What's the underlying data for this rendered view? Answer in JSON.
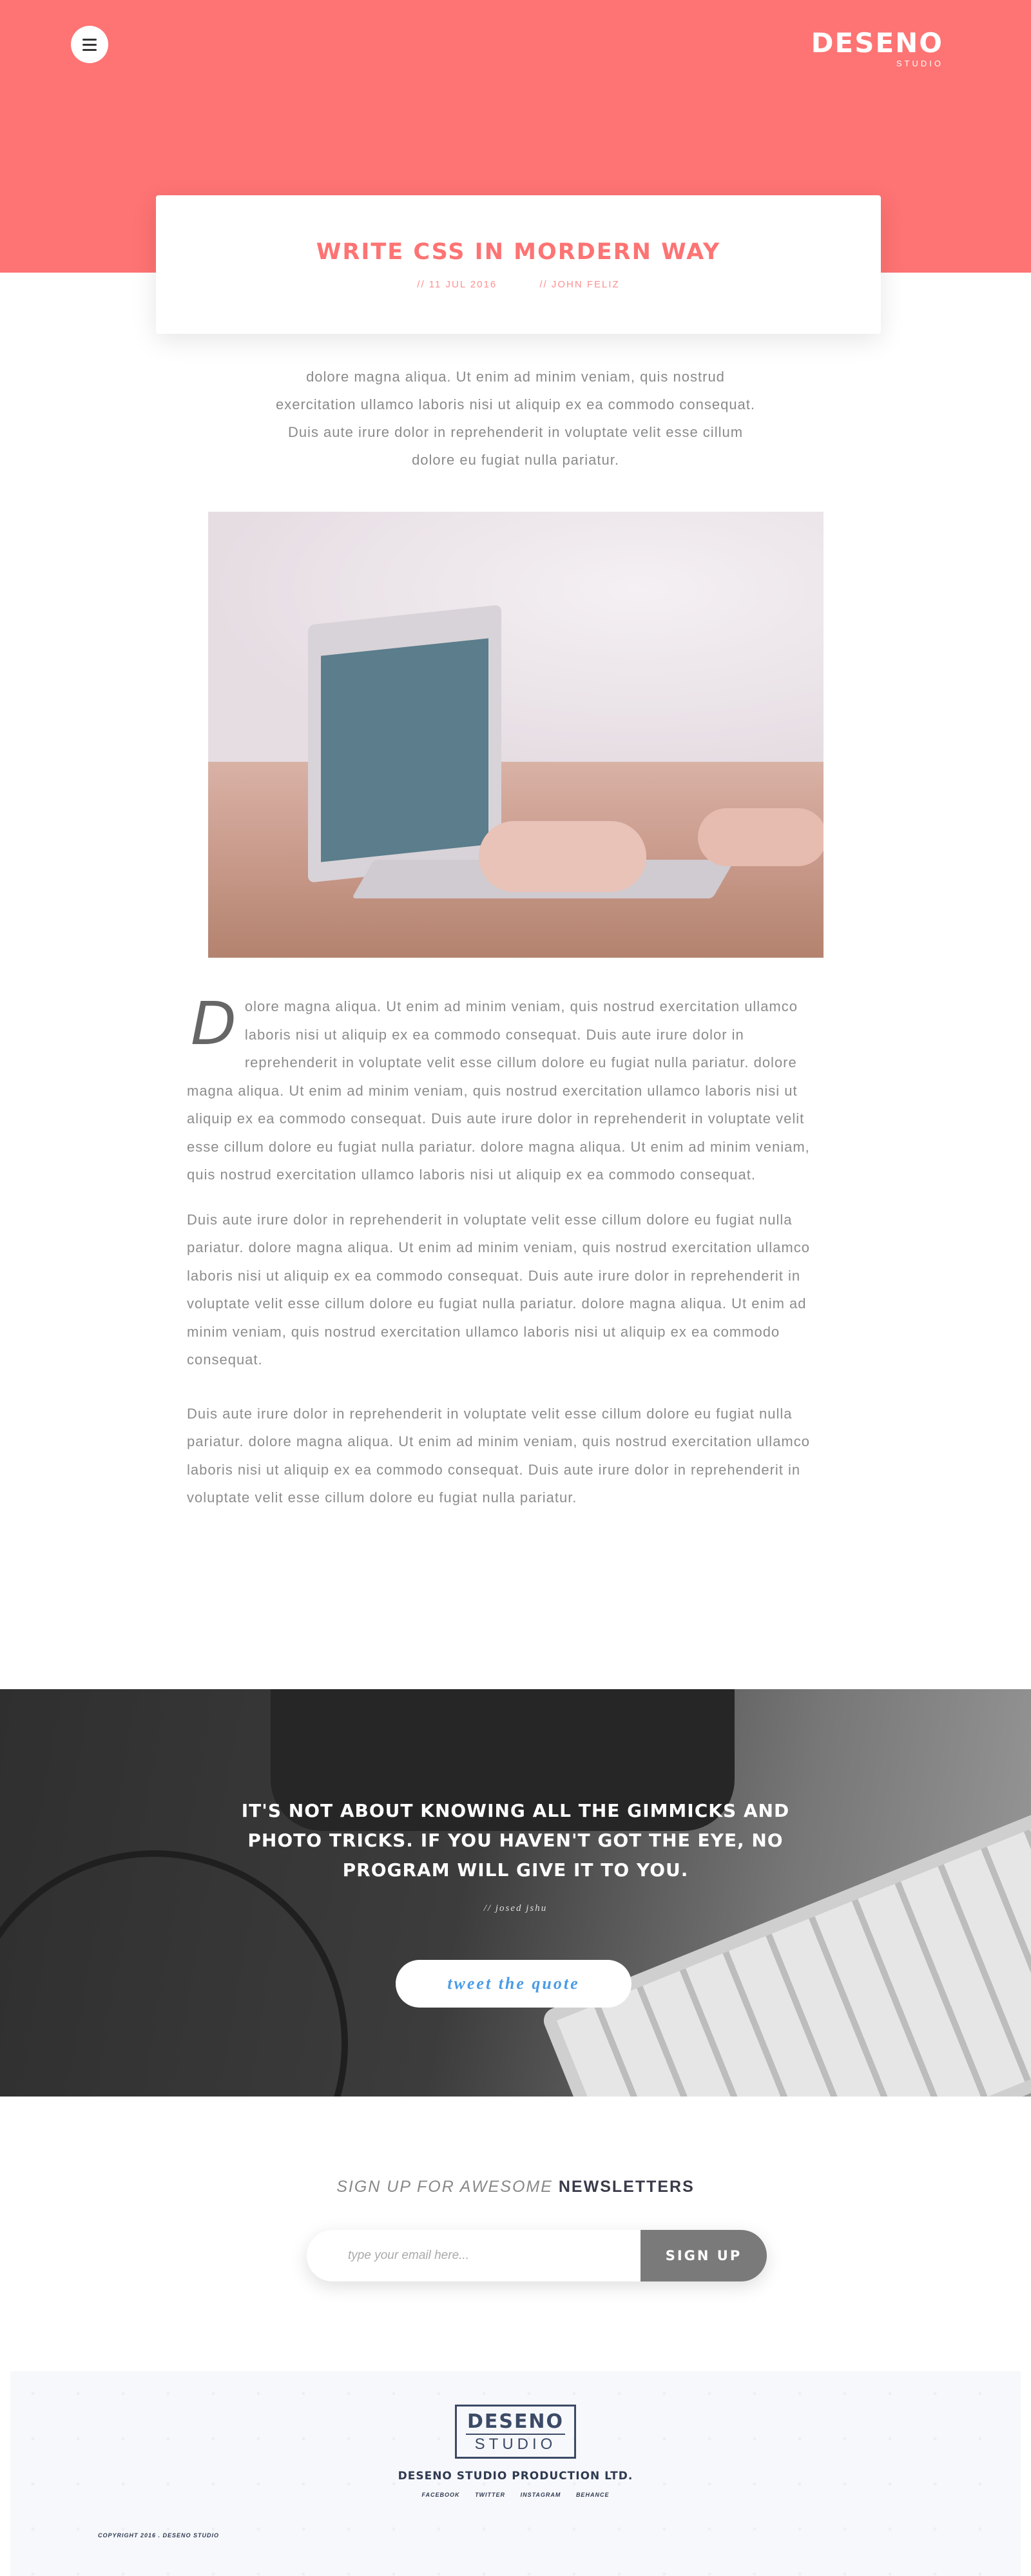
{
  "header": {
    "menu_icon": "hamburger-menu-icon",
    "brand_name": "DESENO",
    "brand_sub": "STUDIO",
    "accent_color": "#fe7373"
  },
  "post": {
    "title": "WRITE CSS IN MORDERN WAY",
    "date": "// 11 JUL 2016",
    "author": "// JOHN FELIZ"
  },
  "intro": "dolore magna aliqua. Ut enim ad minim veniam, quis nostrud exercitation ullamco laboris nisi ut aliquip ex ea commodo consequat. Duis aute irure dolor in reprehenderit in voluptate velit esse cillum dolore eu fugiat nulla pariatur.",
  "article": {
    "dropcap": "D",
    "p1": "olore magna aliqua. Ut enim ad minim veniam, quis nostrud exercitation ullamco laboris nisi ut aliquip ex ea commodo consequat. Duis aute irure dolor in reprehenderit in voluptate velit esse cillum dolore eu fugiat nulla pariatur. dolore magna aliqua. Ut enim ad minim veniam, quis nostrud exercitation ullamco laboris nisi ut aliquip ex ea commodo consequat. Duis aute irure dolor in reprehenderit in voluptate velit esse cillum dolore eu fugiat nulla pariatur. dolore magna aliqua. Ut enim ad minim veniam, quis nostrud exercitation ullamco laboris nisi ut aliquip ex ea commodo consequat.",
    "p2": "Duis aute irure dolor in reprehenderit in voluptate velit esse cillum dolore eu fugiat nulla pariatur. dolore magna aliqua. Ut enim ad minim veniam, quis nostrud exercitation ullamco laboris nisi ut aliquip ex ea commodo consequat. Duis aute irure dolor in reprehenderit in voluptate velit esse cillum dolore eu fugiat nulla pariatur. dolore magna aliqua. Ut enim ad minim veniam, quis nostrud exercitation ullamco laboris nisi ut aliquip ex ea commodo consequat.",
    "p3": "Duis aute irure dolor in reprehenderit in voluptate velit esse cillum dolore eu fugiat nulla pariatur. dolore magna aliqua. Ut enim ad minim veniam, quis nostrud exercitation ullamco laboris nisi ut aliquip ex ea commodo consequat. Duis aute irure dolor in reprehenderit in voluptate velit esse cillum dolore eu fugiat nulla pariatur."
  },
  "quote": {
    "text": "IT'S NOT ABOUT KNOWING ALL THE GIMMICKS AND PHOTO TRICKS. IF YOU HAVEN'T GOT THE EYE, NO PROGRAM WILL GIVE IT TO YOU.",
    "author": "// josed jshu",
    "button_label": "tweet the quote",
    "button_color": "#4a9be6"
  },
  "newsletter": {
    "heading_light": "SIGN UP FOR AWESOME ",
    "heading_strong": "NEWSLETTERS",
    "placeholder": "type your email here...",
    "submit_label": "SIGN UP"
  },
  "footer": {
    "logo_top": "DESENO",
    "logo_bottom": "STUDIO",
    "company": "DESENO STUDIO PRODUCTION LTD.",
    "social": [
      "FACEBOOK",
      "TWITTER",
      "INSTAGRAM",
      "BEHANCE"
    ],
    "copyright": "COPYRIGHT 2016 . DESENO STUDIO"
  }
}
